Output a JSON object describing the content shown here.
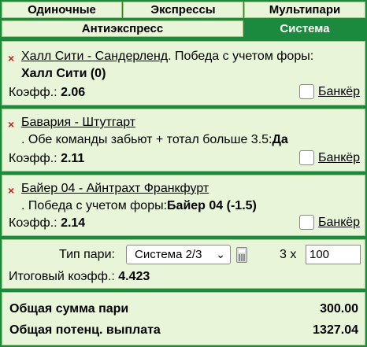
{
  "tabs": [
    {
      "label": "Одиночные",
      "active": false
    },
    {
      "label": "Экспрессы",
      "active": false
    },
    {
      "label": "Мультипари",
      "active": false
    },
    {
      "label": "Антиэкспресс",
      "active": false
    },
    {
      "label": "Система",
      "active": true
    }
  ],
  "bets": [
    {
      "remove": "×",
      "match": "Халл Сити - Сандерленд",
      "market": ". Победа с учетом форы:",
      "selection": "Халл Сити (0)",
      "odds_label": "Коэфф.:",
      "odds": "2.06",
      "banker_label": "Банкёр"
    },
    {
      "remove": "×",
      "match": "Бавария - Штутгарт",
      "market": ". Обе команды забьют + тотал больше 3.5:",
      "selection": "Да",
      "odds_label": "Коэфф.:",
      "odds": "2.11",
      "banker_label": "Банкёр"
    },
    {
      "remove": "×",
      "match": "Байер 04 - Айнтрахт Франкфурт",
      "market": ". Победа с учетом форы:",
      "selection": "Байер 04 (-1.5)",
      "odds_label": "Коэфф.:",
      "odds": "2.14",
      "banker_label": "Банкёр"
    }
  ],
  "system": {
    "type_label": "Тип пари:",
    "type_value": "Система 2/3",
    "multiplier": "3 x",
    "stake": "100",
    "total_odds_label": "Итоговый коэфф.:",
    "total_odds": "4.423"
  },
  "totals": {
    "stake_label": "Общая сумма пари",
    "stake_value": "300.00",
    "payout_label": "Общая потенц. выплата",
    "payout_value": "1327.04"
  },
  "colors": {
    "accent": "#1c8a3e",
    "panel": "#e8f5d8",
    "remove": "#c0211f"
  }
}
